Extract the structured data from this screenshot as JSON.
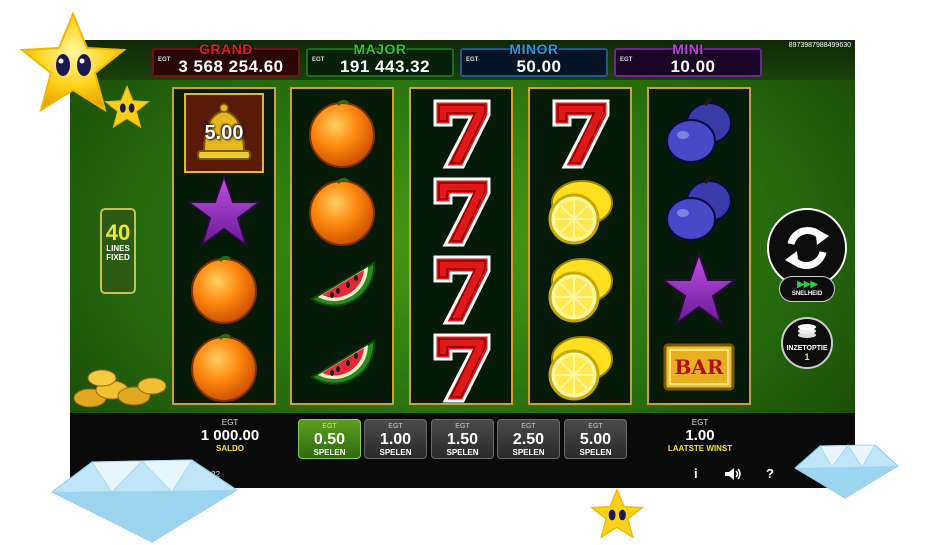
{
  "jackpots": [
    {
      "name": "GRAND",
      "egt": "EGT",
      "value": "3 568 254.60",
      "color": "#e02020"
    },
    {
      "name": "MAJOR",
      "egt": "EGT",
      "value": "191 443.32",
      "color": "#2ec82e"
    },
    {
      "name": "MINOR",
      "egt": "EGT",
      "value": "50.00",
      "color": "#2a9ae0"
    },
    {
      "name": "MINI",
      "egt": "EGT",
      "value": "10.00",
      "color": "#c040e0"
    }
  ],
  "ticker": "8973987988499630",
  "lines": {
    "count": "40",
    "label1": "LINES",
    "label2": "FIXED"
  },
  "bell_value": "5.00",
  "reels": [
    [
      "bell",
      "star",
      "orange",
      "orange"
    ],
    [
      "orange",
      "orange",
      "watermelon",
      "watermelon"
    ],
    [
      "seven",
      "seven",
      "seven",
      "seven"
    ],
    [
      "seven",
      "lemon",
      "lemon",
      "lemon"
    ],
    [
      "plum",
      "plum",
      "star",
      "bar"
    ]
  ],
  "bar_symbol_text": "BAR",
  "speed": {
    "label": "SNELHEID"
  },
  "bet_option": {
    "label": "INZETOPTIE",
    "value": "1"
  },
  "balance": {
    "egt": "EGT",
    "value": "1 000.00",
    "label": "SALDO"
  },
  "bets": [
    {
      "egt": "EGT",
      "value": "0.50",
      "label": "SPELEN",
      "active": true
    },
    {
      "egt": "EGT",
      "value": "1.00",
      "label": "SPELEN",
      "active": false
    },
    {
      "egt": "EGT",
      "value": "1.50",
      "label": "SPELEN",
      "active": false
    },
    {
      "egt": "EGT",
      "value": "2.50",
      "label": "SPELEN",
      "active": false
    },
    {
      "egt": "EGT",
      "value": "5.00",
      "label": "SPELEN",
      "active": false
    }
  ],
  "last_win": {
    "egt": "EGT",
    "value": "1.00",
    "label": "LAATSTE WINST"
  },
  "clock": "10:22",
  "icons": {
    "info": "i",
    "sound": "speaker-icon",
    "help": "?"
  }
}
